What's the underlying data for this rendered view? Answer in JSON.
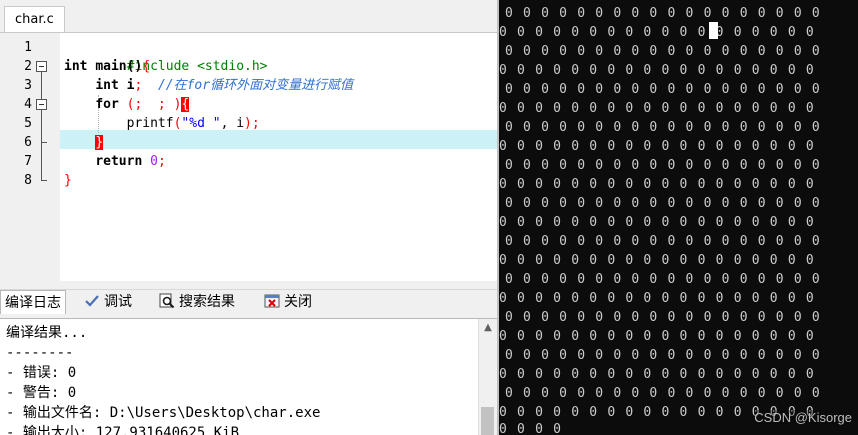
{
  "editor": {
    "tab_label": "char.c",
    "line_numbers": [
      "1",
      "2",
      "3",
      "4",
      "5",
      "6",
      "7",
      "8"
    ],
    "code": {
      "l1_include": "#include <stdio.h>",
      "l2_int": "int ",
      "l2_main": "main()",
      "l2_brace": "{",
      "l3_indent": "    ",
      "l3_int": "int ",
      "l3_var": "i",
      "l3_semi": ";",
      "l3_gap": "  ",
      "l3_comment": "//在for循环外面对变量进行赋值",
      "l4_indent": "    ",
      "l4_for": "for ",
      "l4_open": "(",
      "l4_mid1": "; ",
      "l4_semi": " ; ",
      "l4_close": ")",
      "l4_brace": "{",
      "l5_indent": "        ",
      "l5_printf": "printf",
      "l5_open": "(",
      "l5_str": "\"%d \"",
      "l5_rest": ", i",
      "l5_close": ")",
      "l5_semi": ";",
      "l6_indent": "    ",
      "l6_brace": "}",
      "l7_indent": "    ",
      "l7_return": "return ",
      "l7_zero": "0",
      "l7_semi": ";",
      "l8_brace": "}"
    }
  },
  "bottom_tabs": {
    "compile_log": "编译日志",
    "debug": "调试",
    "search_results": "搜索结果",
    "close": "关闭"
  },
  "log": {
    "lines": [
      "编译结果...",
      "--------",
      "- 错误: 0",
      "- 警告: 0",
      "- 输出文件名: D:\\Users\\Desktop\\char.exe",
      "- 输出大小: 127.931640625 KiB"
    ]
  },
  "console": {
    "row_text": "0 0 0 0 0 0 0 0 0 0 0 0 0 0 0 0 0 0",
    "last_row_text": "0 0 0 0",
    "watermark": "CSDN @Kisorge"
  },
  "colors": {
    "preprocessor": "#008000",
    "bracket": "#ff0000",
    "string": "#0000ff",
    "number": "#a020f0",
    "comment": "#2f6fd1",
    "current_line": "#ccf2f7",
    "console_bg": "#0c0c0c"
  },
  "icons": {
    "debug": "checkmark-icon",
    "search": "magnifier-icon",
    "close": "close-window-icon"
  }
}
